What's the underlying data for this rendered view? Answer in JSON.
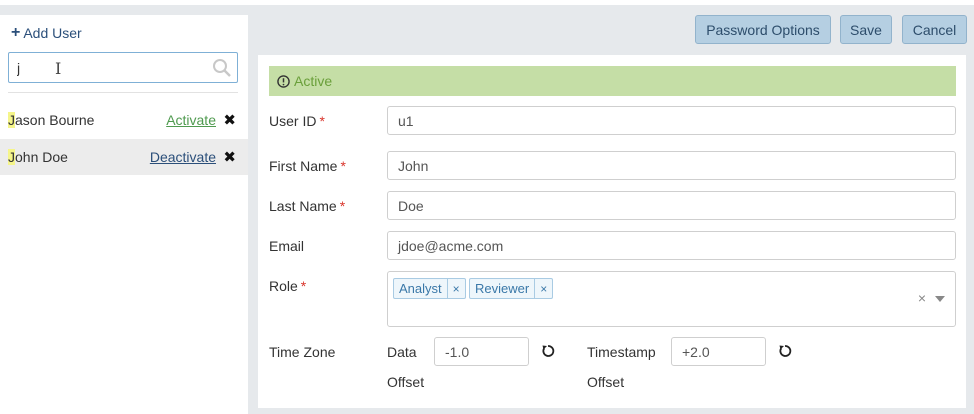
{
  "left_panel": {
    "add_user_label": "Add User",
    "search_value": "j",
    "users": [
      {
        "first_letter": "J",
        "rest": "ason Bourne",
        "action": "Activate"
      },
      {
        "first_letter": "J",
        "rest": "ohn Doe",
        "action": "Deactivate"
      }
    ]
  },
  "toolbar": {
    "password_options": "Password Options",
    "save": "Save",
    "cancel": "Cancel"
  },
  "form": {
    "status": "Active",
    "user_id_label": "User ID",
    "user_id_value": "u1",
    "first_name_label": "First Name",
    "first_name_value": "John",
    "last_name_label": "Last Name",
    "last_name_value": "Doe",
    "email_label": "Email",
    "email_value": "jdoe@acme.com",
    "role_label": "Role",
    "roles": [
      "Analyst",
      "Reviewer"
    ],
    "role_clear": "×",
    "tag_remove": "×",
    "required_mark": "*",
    "time_zone_label": "Time Zone",
    "data_offset_label_1": "Data",
    "data_offset_label_2": "Offset",
    "data_offset_value": "-1.0",
    "timestamp_offset_label_1": "Timestamp",
    "timestamp_offset_label_2": "Offset",
    "timestamp_offset_value": "+2.0"
  },
  "colors": {
    "status_bg": "#c5dea6",
    "status_text": "#6a9f3a",
    "button_bg": "#b5cfe2",
    "required": "#d9342b",
    "link_activate": "#4f9a4f",
    "link_deactivate": "#2b4f7a"
  },
  "icons": {
    "add": "plus-icon",
    "search": "search-icon",
    "remove": "close-icon",
    "status": "info-icon",
    "reset": "reset-icon"
  }
}
